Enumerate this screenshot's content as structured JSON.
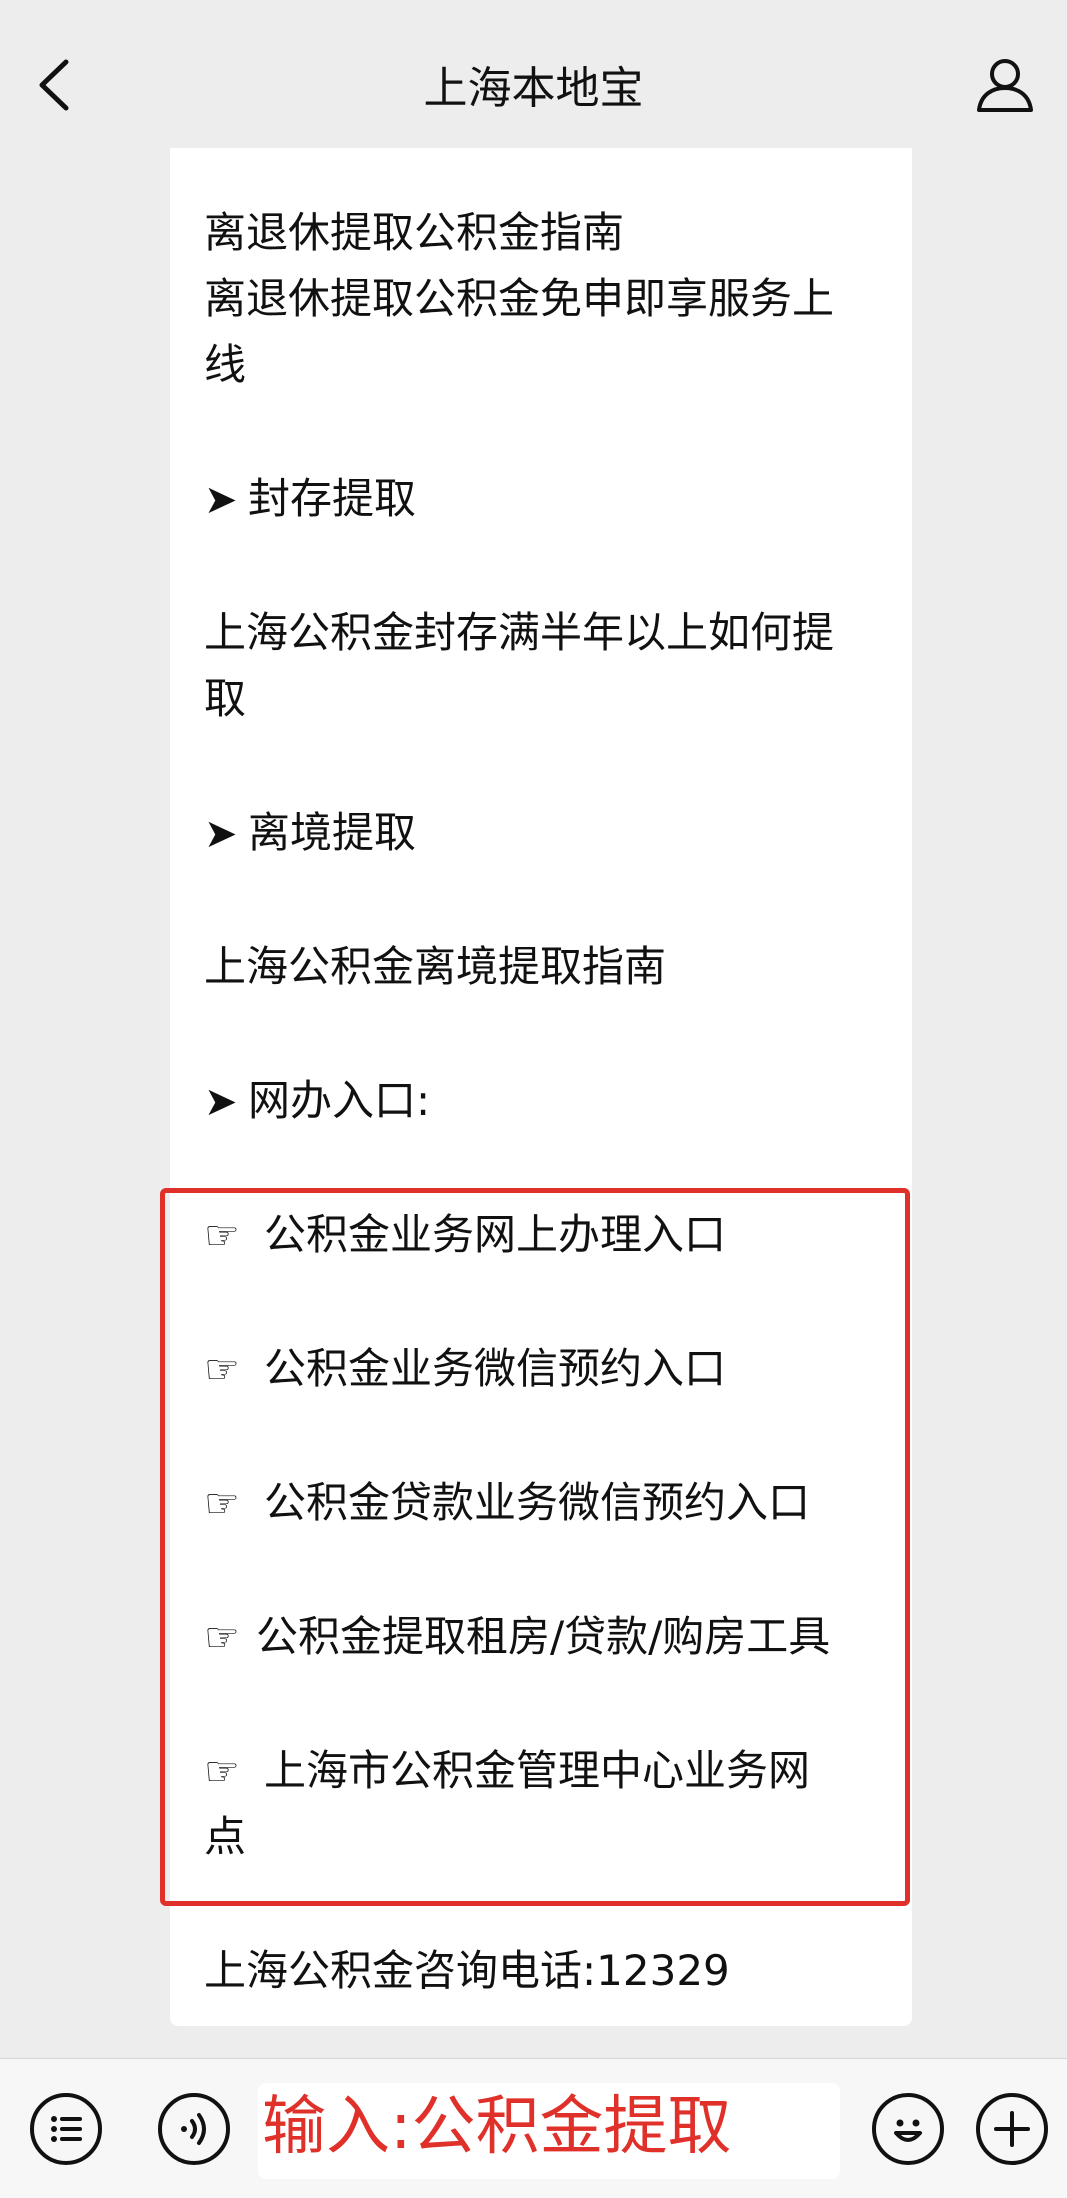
{
  "header": {
    "title": "上海本地宝"
  },
  "article": {
    "lines": [
      "离退休提取公积金指南",
      "离退休提取公积金免申即享服务上",
      "线",
      "封存提取",
      "上海公积金封存满半年以上如何提",
      "取",
      "离境提取",
      "上海公积金离境提取指南",
      "网办入口:",
      "公积金业务网上办理入口",
      "公积金业务微信预约入口",
      "公积金贷款业务微信预约入口",
      "公积金提取租房/贷款/购房工具",
      "上海市公积金管理中心业务网",
      "点",
      "上海公积金咨询电话:12329"
    ],
    "arrow_glyph": "➤",
    "hand_glyph": "☞"
  },
  "bottom_bar": {
    "input_text": "输入:公积金提取",
    "icons": [
      "menu-list-icon",
      "voice-icon",
      "emoji-icon",
      "plus-icon"
    ]
  },
  "colors": {
    "link": "#576b95",
    "highlight_red": "#e0302a",
    "background": "#ededed"
  }
}
